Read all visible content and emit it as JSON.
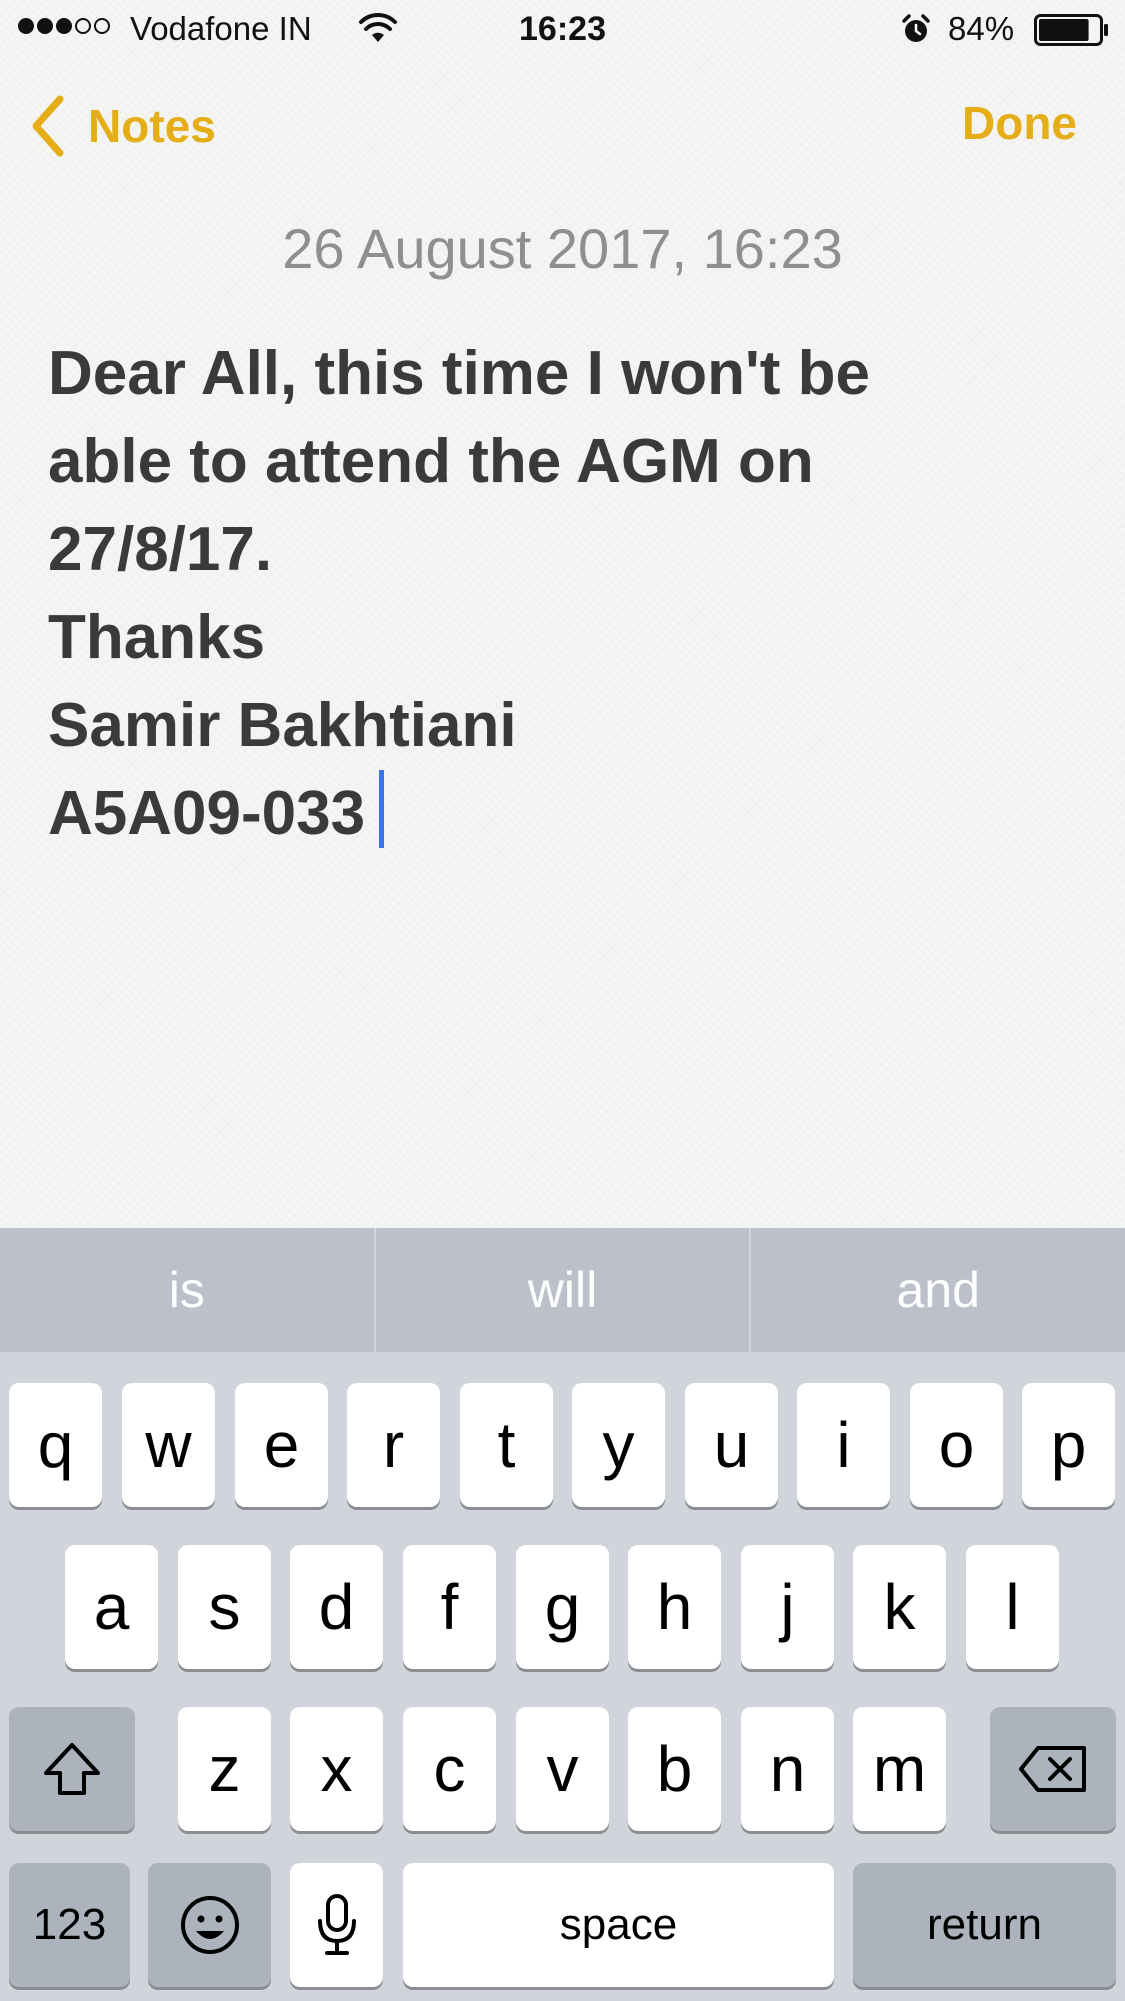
{
  "status_bar": {
    "signal_filled": 3,
    "signal_total": 5,
    "carrier": "Vodafone IN",
    "time": "16:23",
    "battery_percent": "84%",
    "battery_level": 0.84,
    "icons": [
      "signal-dots-icon",
      "wifi-icon",
      "alarm-icon",
      "battery-icon"
    ]
  },
  "nav": {
    "back_label": "Notes",
    "done_label": "Done",
    "accent_color": "#e5ad17"
  },
  "note": {
    "date": "26 August 2017, 16:23",
    "lines": [
      "Dear All, this time I won't be",
      "able to attend the AGM on",
      "27/8/17.",
      "Thanks",
      "Samir Bakhtiani",
      "A5A09-033"
    ]
  },
  "keyboard": {
    "predictions": [
      "is",
      "will",
      "and"
    ],
    "row1": [
      "q",
      "w",
      "e",
      "r",
      "t",
      "y",
      "u",
      "i",
      "o",
      "p"
    ],
    "row2": [
      "a",
      "s",
      "d",
      "f",
      "g",
      "h",
      "j",
      "k",
      "l"
    ],
    "row3": [
      "z",
      "x",
      "c",
      "v",
      "b",
      "n",
      "m"
    ],
    "numbers_label": "123",
    "space_label": "space",
    "return_label": "return",
    "icons": [
      "shift-icon",
      "backspace-icon",
      "emoji-icon",
      "microphone-icon"
    ]
  }
}
